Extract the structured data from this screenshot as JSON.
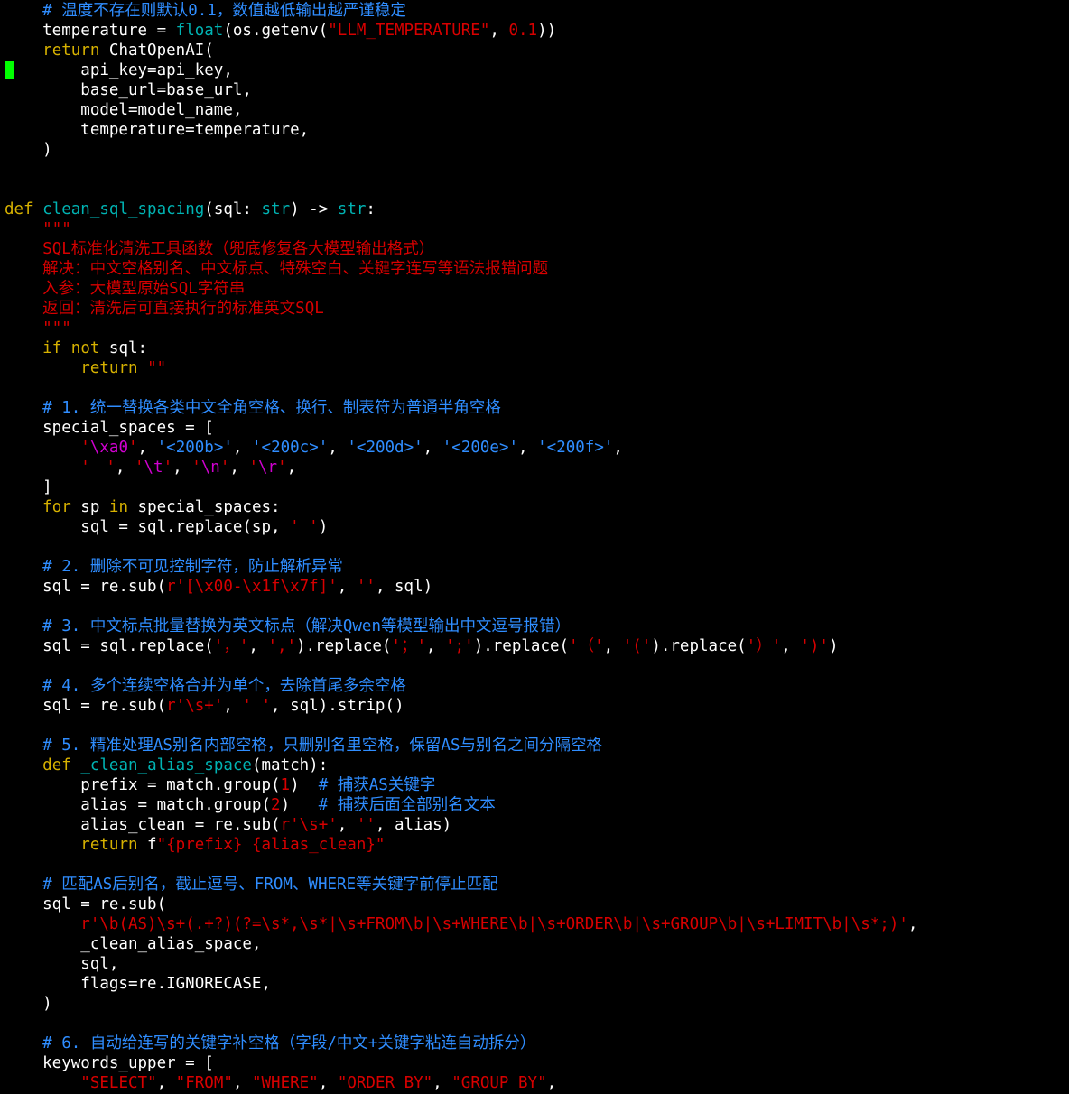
{
  "editor": {
    "cursor_color": "#00ff00",
    "colors": {
      "comment": "#2f8dff",
      "keyword": "#d6b100",
      "string": "#d70000",
      "escape": "#d000d0",
      "builtin": "#00b3b3",
      "plain": "#ffffff",
      "background": "#000000"
    },
    "lines": [
      {
        "segs": [
          {
            "t": "    ",
            "c": "plain"
          },
          {
            "t": "# 温度不存在则默认0.1，数值越低输出越严谨稳定",
            "c": "comment"
          }
        ]
      },
      {
        "segs": [
          {
            "t": "    temperature = ",
            "c": "plain"
          },
          {
            "t": "float",
            "c": "builtin"
          },
          {
            "t": "(os.getenv(",
            "c": "plain"
          },
          {
            "t": "\"LLM_TEMPERATURE\"",
            "c": "string"
          },
          {
            "t": ", ",
            "c": "plain"
          },
          {
            "t": "0.1",
            "c": "number"
          },
          {
            "t": "))",
            "c": "plain"
          }
        ]
      },
      {
        "segs": [
          {
            "t": "    ",
            "c": "plain"
          },
          {
            "t": "return",
            "c": "keyword"
          },
          {
            "t": " ChatOpenAI(",
            "c": "plain"
          }
        ]
      },
      {
        "segs": [
          {
            "t": "        api_key=api_key,",
            "c": "plain"
          }
        ]
      },
      {
        "segs": [
          {
            "t": "        base_url=base_url,",
            "c": "plain"
          }
        ]
      },
      {
        "segs": [
          {
            "t": "        model=model_name,",
            "c": "plain"
          }
        ]
      },
      {
        "segs": [
          {
            "t": "        temperature=temperature,",
            "c": "plain"
          }
        ]
      },
      {
        "segs": [
          {
            "t": "    )",
            "c": "plain"
          }
        ]
      },
      {
        "segs": []
      },
      {
        "segs": []
      },
      {
        "segs": [
          {
            "t": "def",
            "c": "keyword"
          },
          {
            "t": " ",
            "c": "plain"
          },
          {
            "t": "clean_sql_spacing",
            "c": "builtin"
          },
          {
            "t": "(sql: ",
            "c": "plain"
          },
          {
            "t": "str",
            "c": "builtin"
          },
          {
            "t": ") -> ",
            "c": "plain"
          },
          {
            "t": "str",
            "c": "builtin"
          },
          {
            "t": ":",
            "c": "plain"
          }
        ]
      },
      {
        "segs": [
          {
            "t": "    ",
            "c": "plain"
          },
          {
            "t": "\"\"\"",
            "c": "string"
          }
        ]
      },
      {
        "segs": [
          {
            "t": "    ",
            "c": "plain"
          },
          {
            "t": "SQL标准化清洗工具函数（兜底修复各大模型输出格式）",
            "c": "string"
          }
        ]
      },
      {
        "segs": [
          {
            "t": "    ",
            "c": "plain"
          },
          {
            "t": "解决：中文空格别名、中文标点、特殊空白、关键字连写等语法报错问题",
            "c": "string"
          }
        ]
      },
      {
        "segs": [
          {
            "t": "    ",
            "c": "plain"
          },
          {
            "t": "入参：大模型原始SQL字符串",
            "c": "string"
          }
        ]
      },
      {
        "segs": [
          {
            "t": "    ",
            "c": "plain"
          },
          {
            "t": "返回：清洗后可直接执行的标准英文SQL",
            "c": "string"
          }
        ]
      },
      {
        "segs": [
          {
            "t": "    ",
            "c": "plain"
          },
          {
            "t": "\"\"\"",
            "c": "string"
          }
        ]
      },
      {
        "segs": [
          {
            "t": "    ",
            "c": "plain"
          },
          {
            "t": "if",
            "c": "keyword"
          },
          {
            "t": " ",
            "c": "plain"
          },
          {
            "t": "not",
            "c": "keyword"
          },
          {
            "t": " sql:",
            "c": "plain"
          }
        ]
      },
      {
        "segs": [
          {
            "t": "        ",
            "c": "plain"
          },
          {
            "t": "return",
            "c": "keyword"
          },
          {
            "t": " ",
            "c": "plain"
          },
          {
            "t": "\"\"",
            "c": "string"
          }
        ]
      },
      {
        "segs": []
      },
      {
        "segs": [
          {
            "t": "    ",
            "c": "plain"
          },
          {
            "t": "# 1. 统一替换各类中文全角空格、换行、制表符为普通半角空格",
            "c": "comment"
          }
        ]
      },
      {
        "segs": [
          {
            "t": "    special_spaces = [",
            "c": "plain"
          }
        ]
      },
      {
        "segs": [
          {
            "t": "        ",
            "c": "plain"
          },
          {
            "t": "'",
            "c": "string"
          },
          {
            "t": "\\xa0",
            "c": "escape"
          },
          {
            "t": "'",
            "c": "string"
          },
          {
            "t": ", ",
            "c": "plain"
          },
          {
            "t": "'<200b>'",
            "c": "comment"
          },
          {
            "t": ", ",
            "c": "plain"
          },
          {
            "t": "'<200c>'",
            "c": "comment"
          },
          {
            "t": ", ",
            "c": "plain"
          },
          {
            "t": "'<200d>'",
            "c": "comment"
          },
          {
            "t": ", ",
            "c": "plain"
          },
          {
            "t": "'<200e>'",
            "c": "comment"
          },
          {
            "t": ", ",
            "c": "plain"
          },
          {
            "t": "'<200f>'",
            "c": "comment"
          },
          {
            "t": ",",
            "c": "plain"
          }
        ]
      },
      {
        "segs": [
          {
            "t": "        ",
            "c": "plain"
          },
          {
            "t": "'　'",
            "c": "string"
          },
          {
            "t": ", ",
            "c": "plain"
          },
          {
            "t": "'",
            "c": "string"
          },
          {
            "t": "\\t",
            "c": "escape"
          },
          {
            "t": "'",
            "c": "string"
          },
          {
            "t": ", ",
            "c": "plain"
          },
          {
            "t": "'",
            "c": "string"
          },
          {
            "t": "\\n",
            "c": "escape"
          },
          {
            "t": "'",
            "c": "string"
          },
          {
            "t": ", ",
            "c": "plain"
          },
          {
            "t": "'",
            "c": "string"
          },
          {
            "t": "\\r",
            "c": "escape"
          },
          {
            "t": "'",
            "c": "string"
          },
          {
            "t": ",",
            "c": "plain"
          }
        ]
      },
      {
        "segs": [
          {
            "t": "    ]",
            "c": "plain"
          }
        ]
      },
      {
        "segs": [
          {
            "t": "    ",
            "c": "plain"
          },
          {
            "t": "for",
            "c": "keyword"
          },
          {
            "t": " sp ",
            "c": "plain"
          },
          {
            "t": "in",
            "c": "keyword"
          },
          {
            "t": " special_spaces:",
            "c": "plain"
          }
        ]
      },
      {
        "segs": [
          {
            "t": "        sql = sql.replace(sp, ",
            "c": "plain"
          },
          {
            "t": "' '",
            "c": "string"
          },
          {
            "t": ")",
            "c": "plain"
          }
        ]
      },
      {
        "segs": []
      },
      {
        "segs": [
          {
            "t": "    ",
            "c": "plain"
          },
          {
            "t": "# 2. 删除不可见控制字符，防止解析异常",
            "c": "comment"
          }
        ]
      },
      {
        "segs": [
          {
            "t": "    sql = re.sub(",
            "c": "plain"
          },
          {
            "t": "r'[\\x00-\\x1f\\x7f]'",
            "c": "string"
          },
          {
            "t": ", ",
            "c": "plain"
          },
          {
            "t": "''",
            "c": "string"
          },
          {
            "t": ", sql)",
            "c": "plain"
          }
        ]
      },
      {
        "segs": []
      },
      {
        "segs": [
          {
            "t": "    ",
            "c": "plain"
          },
          {
            "t": "# 3. 中文标点批量替换为英文标点（解决Qwen等模型输出中文逗号报错）",
            "c": "comment"
          }
        ]
      },
      {
        "segs": [
          {
            "t": "    sql = sql.replace(",
            "c": "plain"
          },
          {
            "t": "'，'",
            "c": "string"
          },
          {
            "t": ", ",
            "c": "plain"
          },
          {
            "t": "','",
            "c": "string"
          },
          {
            "t": ").replace(",
            "c": "plain"
          },
          {
            "t": "'；'",
            "c": "string"
          },
          {
            "t": ", ",
            "c": "plain"
          },
          {
            "t": "';'",
            "c": "string"
          },
          {
            "t": ").replace(",
            "c": "plain"
          },
          {
            "t": "'（'",
            "c": "string"
          },
          {
            "t": ", ",
            "c": "plain"
          },
          {
            "t": "'('",
            "c": "string"
          },
          {
            "t": ").replace(",
            "c": "plain"
          },
          {
            "t": "'）'",
            "c": "string"
          },
          {
            "t": ", ",
            "c": "plain"
          },
          {
            "t": "')'",
            "c": "string"
          },
          {
            "t": ")",
            "c": "plain"
          }
        ]
      },
      {
        "segs": []
      },
      {
        "segs": [
          {
            "t": "    ",
            "c": "plain"
          },
          {
            "t": "# 4. 多个连续空格合并为单个，去除首尾多余空格",
            "c": "comment"
          }
        ]
      },
      {
        "segs": [
          {
            "t": "    sql = re.sub(",
            "c": "plain"
          },
          {
            "t": "r'\\s+'",
            "c": "string"
          },
          {
            "t": ", ",
            "c": "plain"
          },
          {
            "t": "' '",
            "c": "string"
          },
          {
            "t": ", sql).strip()",
            "c": "plain"
          }
        ]
      },
      {
        "segs": []
      },
      {
        "segs": [
          {
            "t": "    ",
            "c": "plain"
          },
          {
            "t": "# 5. 精准处理AS别名内部空格，只删别名里空格，保留AS与别名之间分隔空格",
            "c": "comment"
          }
        ]
      },
      {
        "segs": [
          {
            "t": "    ",
            "c": "plain"
          },
          {
            "t": "def",
            "c": "keyword"
          },
          {
            "t": " ",
            "c": "plain"
          },
          {
            "t": "_clean_alias_space",
            "c": "builtin"
          },
          {
            "t": "(match):",
            "c": "plain"
          }
        ]
      },
      {
        "segs": [
          {
            "t": "        prefix = match.group(",
            "c": "plain"
          },
          {
            "t": "1",
            "c": "number"
          },
          {
            "t": ")  ",
            "c": "plain"
          },
          {
            "t": "# 捕获AS关键字",
            "c": "comment"
          }
        ]
      },
      {
        "segs": [
          {
            "t": "        alias = match.group(",
            "c": "plain"
          },
          {
            "t": "2",
            "c": "number"
          },
          {
            "t": ")   ",
            "c": "plain"
          },
          {
            "t": "# 捕获后面全部别名文本",
            "c": "comment"
          }
        ]
      },
      {
        "segs": [
          {
            "t": "        alias_clean = re.sub(",
            "c": "plain"
          },
          {
            "t": "r'\\s+'",
            "c": "string"
          },
          {
            "t": ", ",
            "c": "plain"
          },
          {
            "t": "''",
            "c": "string"
          },
          {
            "t": ", alias)",
            "c": "plain"
          }
        ]
      },
      {
        "segs": [
          {
            "t": "        ",
            "c": "plain"
          },
          {
            "t": "return",
            "c": "keyword"
          },
          {
            "t": " f",
            "c": "plain"
          },
          {
            "t": "\"{prefix} {alias_clean}\"",
            "c": "string"
          }
        ]
      },
      {
        "segs": []
      },
      {
        "segs": [
          {
            "t": "    ",
            "c": "plain"
          },
          {
            "t": "# 匹配AS后别名，截止逗号、FROM、WHERE等关键字前停止匹配",
            "c": "comment"
          }
        ]
      },
      {
        "segs": [
          {
            "t": "    sql = re.sub(",
            "c": "plain"
          }
        ]
      },
      {
        "segs": [
          {
            "t": "        ",
            "c": "plain"
          },
          {
            "t": "r'\\b(AS)\\s+(.+?)(?=\\s*,\\s*|\\s+FROM\\b|\\s+WHERE\\b|\\s+ORDER\\b|\\s+GROUP\\b|\\s+LIMIT\\b|\\s*;)'",
            "c": "string"
          },
          {
            "t": ",",
            "c": "plain"
          }
        ]
      },
      {
        "segs": [
          {
            "t": "        _clean_alias_space,",
            "c": "plain"
          }
        ]
      },
      {
        "segs": [
          {
            "t": "        sql,",
            "c": "plain"
          }
        ]
      },
      {
        "segs": [
          {
            "t": "        flags=re.IGNORECASE,",
            "c": "plain"
          }
        ]
      },
      {
        "segs": [
          {
            "t": "    )",
            "c": "plain"
          }
        ]
      },
      {
        "segs": []
      },
      {
        "segs": [
          {
            "t": "    ",
            "c": "plain"
          },
          {
            "t": "# 6. 自动给连写的关键字补空格（字段/中文+关键字粘连自动拆分）",
            "c": "comment"
          }
        ]
      },
      {
        "segs": [
          {
            "t": "    keywords_upper = [",
            "c": "plain"
          }
        ]
      },
      {
        "segs": [
          {
            "t": "        ",
            "c": "plain"
          },
          {
            "t": "\"SELECT\"",
            "c": "string"
          },
          {
            "t": ", ",
            "c": "plain"
          },
          {
            "t": "\"FROM\"",
            "c": "string"
          },
          {
            "t": ", ",
            "c": "plain"
          },
          {
            "t": "\"WHERE\"",
            "c": "string"
          },
          {
            "t": ", ",
            "c": "plain"
          },
          {
            "t": "\"ORDER BY\"",
            "c": "string"
          },
          {
            "t": ", ",
            "c": "plain"
          },
          {
            "t": "\"GROUP BY\"",
            "c": "string"
          },
          {
            "t": ",",
            "c": "plain"
          }
        ]
      }
    ]
  }
}
